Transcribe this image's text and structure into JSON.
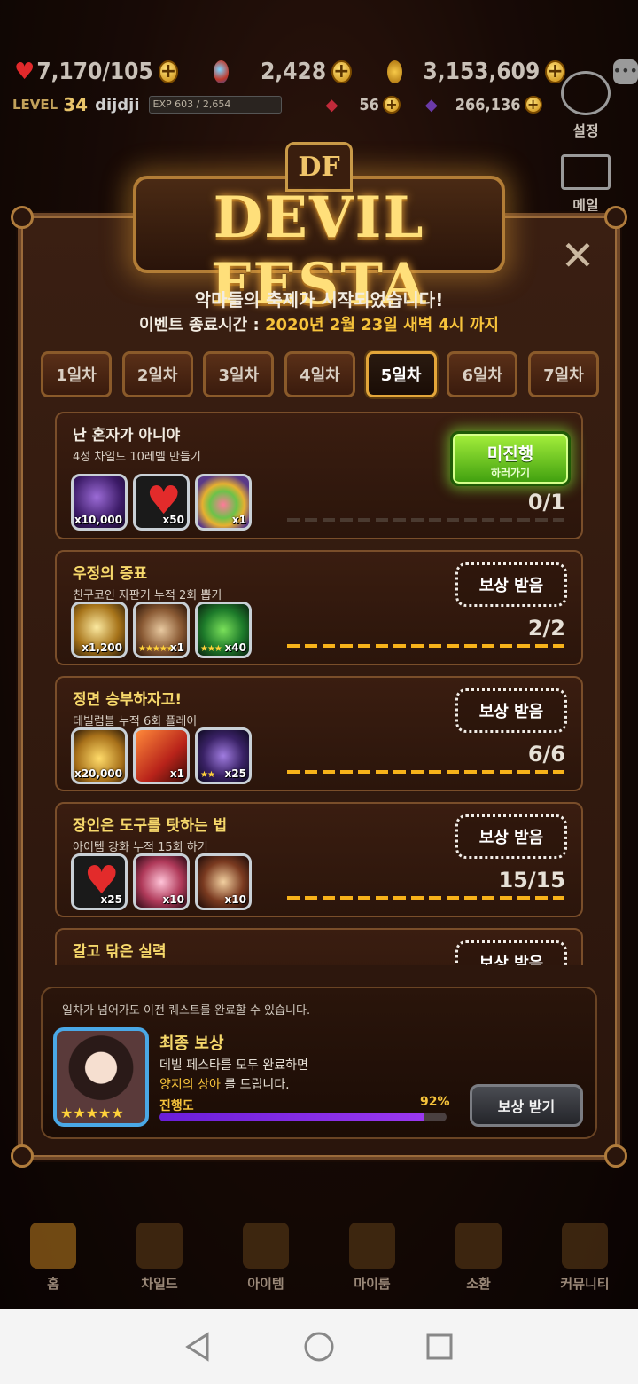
{
  "hud": {
    "hearts": "7,170",
    "hearts_max": "/105",
    "gems": "2,428",
    "gold": "3,153,609",
    "level_label": "LEVEL",
    "level": "34",
    "username": "dijdji",
    "exp_text": "EXP 603 / 2,654",
    "stat_a": "56",
    "stat_b": "266,136"
  },
  "side": {
    "settings_label": "설정",
    "mail_label": "메일"
  },
  "banner": {
    "emblem": "DF",
    "title": "DEVIL FESTA"
  },
  "event": {
    "subtitle": "악마들의 축제가 시작되었습니다!",
    "end_label": "이벤트 종료시간 : ",
    "end_value": "2020년 2월 23일 새벽 4시 까지"
  },
  "tabs": [
    {
      "label": "1일차"
    },
    {
      "label": "2일차"
    },
    {
      "label": "3일차"
    },
    {
      "label": "4일차"
    },
    {
      "label": "5일차"
    },
    {
      "label": "6일차"
    },
    {
      "label": "7일차"
    }
  ],
  "active_tab": 5,
  "quests": [
    {
      "title": "난 혼자가 아니야",
      "desc": "4성 차일드 10레벨 만들기",
      "rewards": [
        {
          "icon": "purple-gem-icon",
          "count": "x10,000"
        },
        {
          "icon": "heart-icon",
          "count": "x50"
        },
        {
          "icon": "potion-icon",
          "count": "x1"
        }
      ],
      "button": "미진행",
      "button_sub": "하러가기",
      "progress": "0/1"
    },
    {
      "title": "우정의 증표",
      "desc": "친구코인 자판기 누적 2회 뽑기",
      "rewards": [
        {
          "icon": "friend-coin-icon",
          "count": "x1,200"
        },
        {
          "icon": "medal-icon",
          "count": "x1",
          "stars": "★★★★★"
        },
        {
          "icon": "green-gem-icon",
          "count": "x40",
          "stars": "★★★"
        }
      ],
      "button": "보상 받음",
      "progress": "2/2"
    },
    {
      "title": "정면 승부하자고!",
      "desc": "데빌럼블 누적 6회 플레이",
      "rewards": [
        {
          "icon": "gold-coins-icon",
          "count": "x20,000"
        },
        {
          "icon": "ticket-icon",
          "count": "x1"
        },
        {
          "icon": "purple-crystal-icon",
          "count": "x25",
          "stars": "★★"
        }
      ],
      "button": "보상 받음",
      "progress": "6/6"
    },
    {
      "title": "장인은 도구를 탓하는 법",
      "desc": "아이템 강화 누적 15회 하기",
      "rewards": [
        {
          "icon": "heart-icon",
          "count": "x25"
        },
        {
          "icon": "pink-crystal-icon",
          "count": "x10"
        },
        {
          "icon": "hammer-icon",
          "count": "x10"
        }
      ],
      "button": "보상 받음",
      "progress": "15/15"
    },
    {
      "title": "갈고 닦은 실력",
      "button": "보상 받음"
    }
  ],
  "final": {
    "note": "일차가 넘어가도 이전 퀘스트를 완료할 수 있습니다.",
    "title": "최종 보상",
    "line1": "데빌 페스타를 모두 완료하면",
    "line2_highlight": "양지의 상아",
    "line2_rest": " 를 드립니다.",
    "progress_label": "진행도",
    "progress_pct": "92%",
    "progress_value": 0.92,
    "stars": "★★★★★",
    "button": "보상 받기"
  },
  "bottom_nav": [
    {
      "label": "홈",
      "icon": "home-icon"
    },
    {
      "label": "차일드",
      "icon": "child-icon"
    },
    {
      "label": "아이템",
      "icon": "item-icon"
    },
    {
      "label": "마이룸",
      "icon": "myroom-icon"
    },
    {
      "label": "소환",
      "icon": "summon-icon"
    },
    {
      "label": "커뮤니티",
      "icon": "community-icon"
    }
  ],
  "colors": {
    "accent_gold": "#f6d86b",
    "progress_orange": "#f7b21a",
    "go_green": "#7ad02a",
    "progress_purple": "#8a2be2"
  }
}
